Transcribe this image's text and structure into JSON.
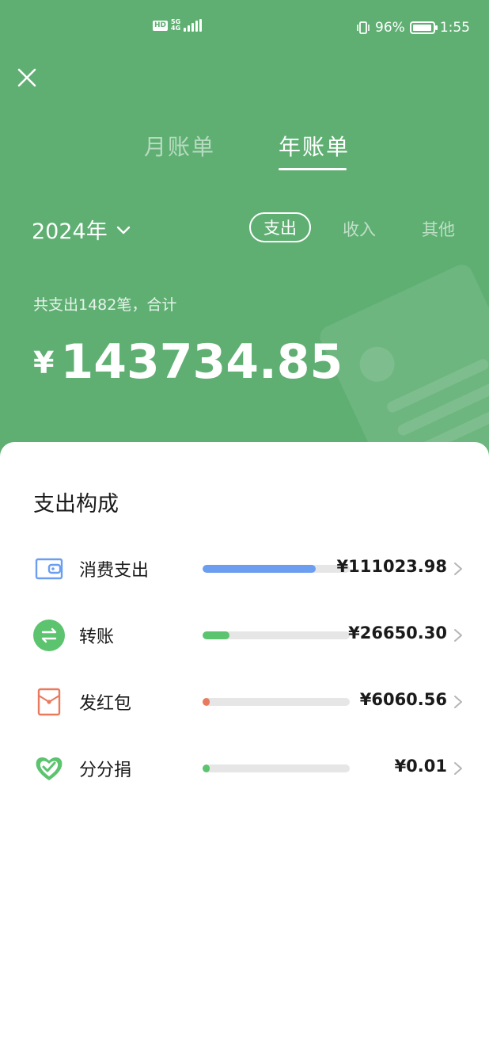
{
  "status_bar": {
    "hd_badge": "HD",
    "network_top": "5G",
    "network_bottom": "4G",
    "battery_percent": "96%",
    "battery_level": 0.96,
    "time": "1:55"
  },
  "header": {
    "close_icon": "close-icon",
    "tabs": [
      {
        "label": "月账单",
        "active": false
      },
      {
        "label": "年账单",
        "active": true
      }
    ],
    "year_label": "2024年",
    "segments": [
      {
        "label": "支出",
        "active": true
      },
      {
        "label": "收入",
        "active": false
      },
      {
        "label": "其他",
        "active": false
      }
    ],
    "summary_text": "共支出1482笔，合计",
    "currency_symbol": "¥",
    "total_amount": "143734.85"
  },
  "breakdown": {
    "title": "支出构成",
    "items": [
      {
        "label": "消费支出",
        "amount": "¥111023.98",
        "share": 0.77,
        "color": "#6b9ef0",
        "icon": "wallet-icon"
      },
      {
        "label": "转账",
        "amount": "¥26650.30",
        "share": 0.185,
        "color": "#5cc36f",
        "icon": "transfer-icon"
      },
      {
        "label": "发红包",
        "amount": "¥6060.56",
        "share": 0.042,
        "color": "#e87a5d",
        "icon": "red-packet-icon"
      },
      {
        "label": "分分捐",
        "amount": "¥0.01",
        "share": 0.0,
        "color": "#5cc36f",
        "icon": "heart-donation-icon"
      }
    ]
  },
  "colors": {
    "header_bg": "#5faf73",
    "accent_blue": "#6b9ef0",
    "accent_green": "#5cc36f",
    "accent_red": "#e87a5d"
  }
}
